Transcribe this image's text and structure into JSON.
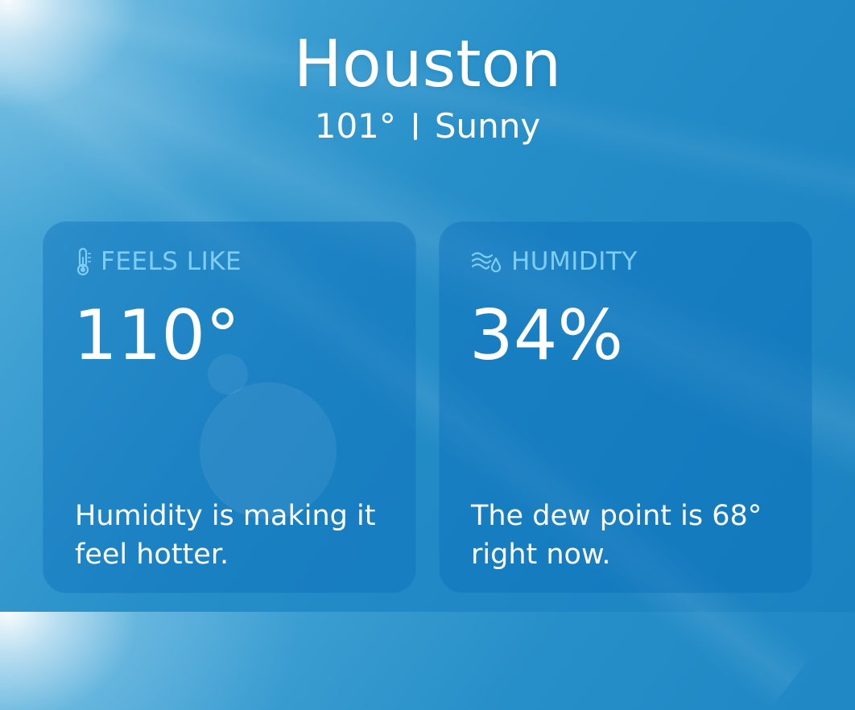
{
  "location": {
    "city": "Houston",
    "temperature": "101°",
    "condition": "Sunny"
  },
  "cards": [
    {
      "icon": "thermometer-icon",
      "title": "FEELS LIKE",
      "value": "110°",
      "description": "Humidity is making it feel hotter."
    },
    {
      "icon": "humidity-icon",
      "title": "HUMIDITY",
      "value": "34%",
      "description": "The dew point is 68° right now."
    }
  ],
  "colors": {
    "background": "#268ec8",
    "card_title": "#7fcdf3",
    "text": "#ffffff"
  }
}
